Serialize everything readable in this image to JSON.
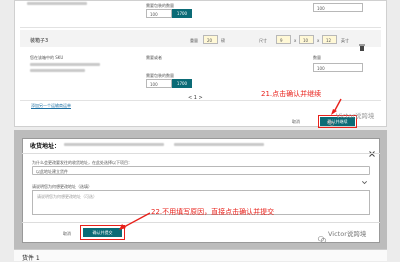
{
  "panel1": {
    "top_row": {
      "qty_label": "需要包装的数量",
      "qty_value": "100",
      "unit_count": "1700",
      "right_value": "100"
    },
    "group": {
      "title": "装箱子3",
      "weight_label": "重量",
      "weight_value": "20",
      "weight_unit": "磅",
      "dims_label": "尺寸",
      "dims": [
        "9",
        "10",
        "12"
      ],
      "dims_unit": "英寸"
    },
    "cols": {
      "sku": "您在该箱中的 SKU",
      "fba": "需要或者",
      "qty": "数量"
    },
    "row": {
      "qty_label": "需要包装的数量",
      "qty_value": "100",
      "unit_count": "1700",
      "right_value": "100"
    },
    "pagination": "< 1 >",
    "link": "添加另一个运输商运单",
    "cancel": "取消",
    "confirm": "确认并继续",
    "annotation": "21.点击确认并继续"
  },
  "dialog": {
    "title": "收货地址：",
    "q1_label": "为什么会更改要发往的收货地址，在此处选择以下项目：",
    "q1_value": "以此地址建立货件",
    "q2_label": "请说明您为何想更改地址（选填）",
    "q2_placeholder": "请说明您为何想更改地址（可选）",
    "cancel": "取消",
    "confirm": "确认并提交",
    "annotation": "22.不用填写原因，直接点击确认并提交"
  },
  "bottom": {
    "title": "货件 1"
  },
  "watermark": "Victor说跨境",
  "colors": {
    "teal": "#0b6b76",
    "annotation_red": "#e8201a"
  },
  "icons": [
    "close-icon",
    "chevron-down-icon",
    "trash-icon",
    "wechat-logo-icon"
  ]
}
